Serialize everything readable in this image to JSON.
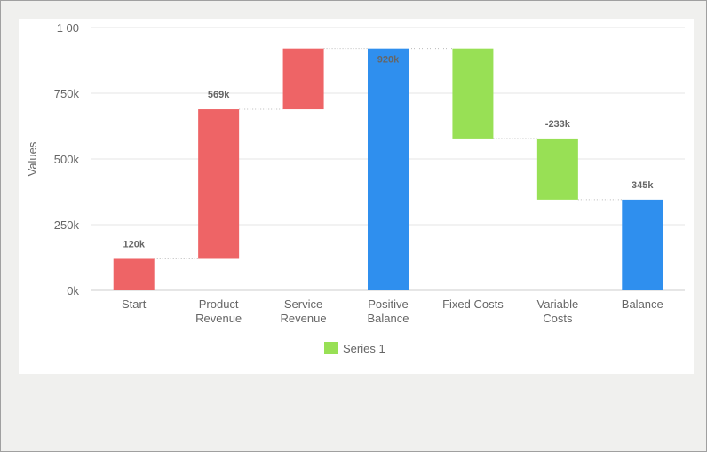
{
  "chart_data": {
    "type": "waterfall",
    "title": "",
    "xlabel": "",
    "ylabel": "Values",
    "ylim": [
      0,
      1000000
    ],
    "yticks": [
      {
        "value": 0,
        "label": "0k"
      },
      {
        "value": 250000,
        "label": "250k"
      },
      {
        "value": 500000,
        "label": "500k"
      },
      {
        "value": 750000,
        "label": "750k"
      },
      {
        "value": 1000000,
        "label": "1 00"
      }
    ],
    "grid": true,
    "legend_position": "bottom-center",
    "categories": [
      {
        "line1": "Start",
        "line2": ""
      },
      {
        "line1": "Product",
        "line2": "Revenue"
      },
      {
        "line1": "Service",
        "line2": "Revenue"
      },
      {
        "line1": "Positive",
        "line2": "Balance"
      },
      {
        "line1": "Fixed Costs",
        "line2": ""
      },
      {
        "line1": "Variable",
        "line2": "Costs"
      },
      {
        "line1": "Balance",
        "line2": ""
      }
    ],
    "bars": [
      {
        "kind": "increase",
        "start": 0,
        "end": 120000,
        "label": "120k"
      },
      {
        "kind": "increase",
        "start": 120000,
        "end": 689000,
        "label": "569k"
      },
      {
        "kind": "increase",
        "start": 689000,
        "end": 920000,
        "label": ""
      },
      {
        "kind": "total",
        "start": 0,
        "end": 920000,
        "label": "920k"
      },
      {
        "kind": "decrease",
        "start": 920000,
        "end": 578000,
        "label": ""
      },
      {
        "kind": "decrease",
        "start": 578000,
        "end": 345000,
        "label": "-233k"
      },
      {
        "kind": "total",
        "start": 0,
        "end": 345000,
        "label": "345k"
      }
    ],
    "colors": {
      "increase": "#ee6466",
      "decrease": "#98e055",
      "total": "#2f8fee"
    },
    "series": [
      {
        "name": "Series 1",
        "color": "#98e055"
      }
    ]
  }
}
